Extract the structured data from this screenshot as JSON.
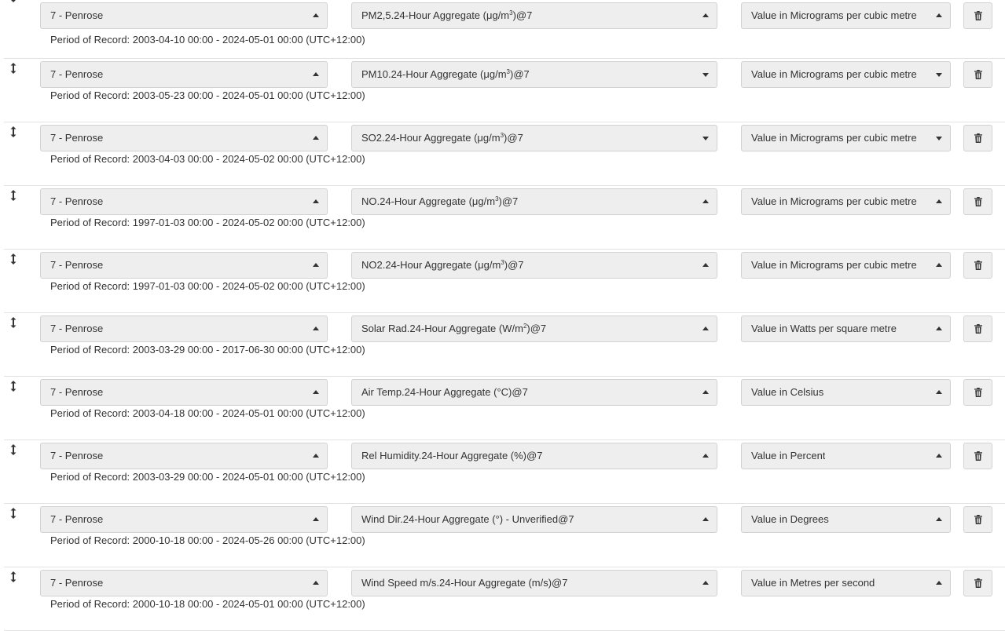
{
  "rows": [
    {
      "site": "7 - Penrose",
      "site_caret": "up",
      "param_pre": "PM2,5.24-Hour Aggregate (μg/m",
      "param_sup": "3",
      "param_post": ")@7",
      "param_caret": "up",
      "unit": "Value in Micrograms per cubic metre",
      "unit_caret": "up",
      "period": "Period of Record: 2003-04-10 00:00 - 2024-05-01 00:00 (UTC+12:00)"
    },
    {
      "site": "7 - Penrose",
      "site_caret": "up",
      "param_pre": "PM10.24-Hour Aggregate (μg/m",
      "param_sup": "3",
      "param_post": ")@7",
      "param_caret": "down",
      "unit": "Value in Micrograms per cubic metre",
      "unit_caret": "down",
      "period": "Period of Record: 2003-05-23 00:00 - 2024-05-01 00:00 (UTC+12:00)"
    },
    {
      "site": "7 - Penrose",
      "site_caret": "up",
      "param_pre": "SO2.24-Hour Aggregate (μg/m",
      "param_sup": "3",
      "param_post": ")@7",
      "param_caret": "down",
      "unit": "Value in Micrograms per cubic metre",
      "unit_caret": "down",
      "period": "Period of Record: 2003-04-03 00:00 - 2024-05-02 00:00 (UTC+12:00)"
    },
    {
      "site": "7 - Penrose",
      "site_caret": "up",
      "param_pre": "NO.24-Hour Aggregate (μg/m",
      "param_sup": "3",
      "param_post": ")@7",
      "param_caret": "up",
      "unit": "Value in Micrograms per cubic metre",
      "unit_caret": "up",
      "period": "Period of Record: 1997-01-03 00:00 - 2024-05-02 00:00 (UTC+12:00)"
    },
    {
      "site": "7 - Penrose",
      "site_caret": "up",
      "param_pre": "NO2.24-Hour Aggregate (μg/m",
      "param_sup": "3",
      "param_post": ")@7",
      "param_caret": "up",
      "unit": "Value in Micrograms per cubic metre",
      "unit_caret": "up",
      "period": "Period of Record: 1997-01-03 00:00 - 2024-05-02 00:00 (UTC+12:00)"
    },
    {
      "site": "7 - Penrose",
      "site_caret": "up",
      "param_pre": "Solar Rad.24-Hour Aggregate (W/m",
      "param_sup": "2",
      "param_post": ")@7",
      "param_caret": "up",
      "unit": "Value in Watts per square metre",
      "unit_caret": "up",
      "period": "Period of Record: 2003-03-29 00:00 - 2017-06-30 00:00 (UTC+12:00)"
    },
    {
      "site": "7 - Penrose",
      "site_caret": "up",
      "param_pre": "Air Temp.24-Hour Aggregate (°C)@7",
      "param_sup": "",
      "param_post": "",
      "param_caret": "up",
      "unit": "Value in Celsius",
      "unit_caret": "up",
      "period": "Period of Record: 2003-04-18 00:00 - 2024-05-01 00:00 (UTC+12:00)"
    },
    {
      "site": "7 - Penrose",
      "site_caret": "up",
      "param_pre": "Rel Humidity.24-Hour Aggregate (%)@7",
      "param_sup": "",
      "param_post": "",
      "param_caret": "up",
      "unit": "Value in Percent",
      "unit_caret": "up",
      "period": "Period of Record: 2003-03-29 00:00 - 2024-05-01 00:00 (UTC+12:00)"
    },
    {
      "site": "7 - Penrose",
      "site_caret": "up",
      "param_pre": "Wind Dir.24-Hour Aggregate (°) - Unverified@7",
      "param_sup": "",
      "param_post": "",
      "param_caret": "up",
      "unit": "Value in Degrees",
      "unit_caret": "up",
      "period": "Period of Record: 2000-10-18 00:00 - 2024-05-26 00:00 (UTC+12:00)"
    },
    {
      "site": "7 - Penrose",
      "site_caret": "up",
      "param_pre": "Wind Speed m/s.24-Hour Aggregate (m/s)@7",
      "param_sup": "",
      "param_post": "",
      "param_caret": "up",
      "unit": "Value in Metres per second",
      "unit_caret": "up",
      "period": "Period of Record: 2000-10-18 00:00 - 2024-05-01 00:00 (UTC+12:00)"
    }
  ],
  "icons": {
    "handle": "drag-handle-icon",
    "delete": "trash-icon",
    "caret": "caret-icon"
  }
}
